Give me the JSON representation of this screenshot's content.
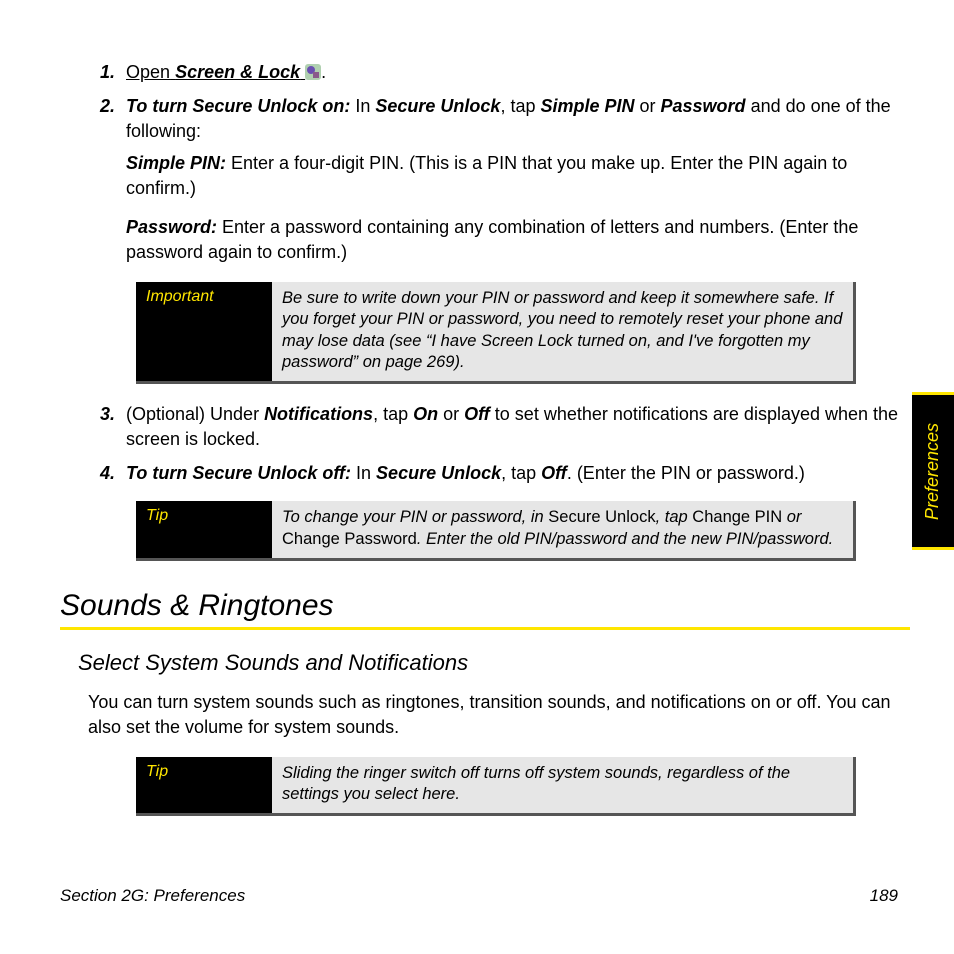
{
  "steps": {
    "s1": {
      "num": "1.",
      "open": "Open",
      "app": "Screen & Lock",
      "period": "."
    },
    "s2": {
      "num": "2.",
      "lead": "To turn Secure Unlock on:",
      "t1": " In ",
      "b1": "Secure Unlock",
      "t2": ", tap ",
      "b2": "Simple PIN",
      "t3": " or ",
      "b3": "Password",
      "t4": " and do one of the following:",
      "p1_label": "Simple PIN:",
      "p1_text": " Enter a four-digit PIN. (This is a PIN that you make up. Enter the PIN again to confirm.)",
      "p2_label": "Password:",
      "p2_text": " Enter a password containing any combination of letters and numbers. (Enter the password again to confirm.)"
    },
    "s3": {
      "num": "3.",
      "t1": "(Optional) Under ",
      "b1": "Notifications",
      "t2": ", tap ",
      "b2": "On",
      "t3": " or ",
      "b3": "Off",
      "t4": " to set whether notifications are displayed when the screen is locked."
    },
    "s4": {
      "num": "4.",
      "lead": "To turn Secure Unlock off:",
      "t1": " In ",
      "b1": "Secure Unlock",
      "t2": ", tap ",
      "b2": "Off",
      "t3": ". (Enter the PIN or password.)"
    }
  },
  "callout_important": {
    "label": "Important",
    "body": "Be sure to write down your PIN or password and keep it somewhere safe. If you forget your PIN or password, you need to remotely reset your phone and may lose data (see “I have Screen Lock turned on, and I've forgotten my password” on page 269)."
  },
  "callout_tip1": {
    "label": "Tip",
    "t1": "To change your PIN or password, in ",
    "n1": "Secure Unlock",
    "t2": ", tap ",
    "n2": "Change PIN",
    "t3": " or ",
    "n3": "Change Password",
    "t4": ". Enter the old PIN/password and the new PIN/password."
  },
  "section_title": "Sounds & Ringtones",
  "subsection_title": "Select System Sounds and Notifications",
  "body_para": "You can turn system sounds such as ringtones, transition sounds, and notifications on or off. You can also set the volume for system sounds.",
  "callout_tip2": {
    "label": "Tip",
    "body": "Sliding the ringer switch off turns off system sounds, regardless of the settings you select here."
  },
  "side_tab": "Preferences",
  "footer": {
    "left": "Section 2G: Preferences",
    "right": "189"
  }
}
